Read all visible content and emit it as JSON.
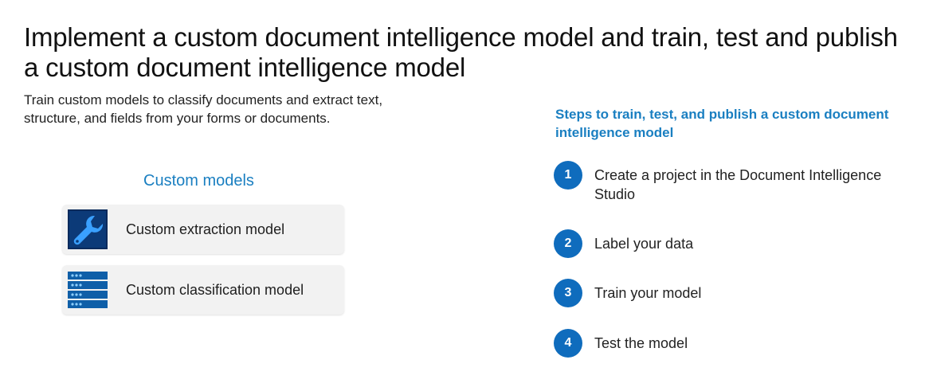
{
  "slide": {
    "title": "Implement a custom document intelligence model and train, test and publish a custom document intelligence model",
    "subtitle": "Train custom models to classify documents and extract text, structure, and fields from your forms or documents."
  },
  "models": {
    "heading": "Custom models",
    "items": [
      {
        "label": "Custom extraction model",
        "icon": "wrench-icon"
      },
      {
        "label": "Custom classification model",
        "icon": "list-rows-icon"
      }
    ]
  },
  "steps": {
    "heading": "Steps to train, test, and publish a custom document intelligence model",
    "items": [
      {
        "number": "1",
        "text": "Create a project in the Document Intelligence Studio"
      },
      {
        "number": "2",
        "text": "Label your data"
      },
      {
        "number": "3",
        "text": "Train your model"
      },
      {
        "number": "4",
        "text": "Test the model"
      }
    ]
  },
  "colors": {
    "accent": "#1a7fc1",
    "step_circle": "#0f6cbd",
    "card_background": "#f2f2f2",
    "icon_dark": "#0a2a5c",
    "icon_light": "#3aa0ff"
  }
}
